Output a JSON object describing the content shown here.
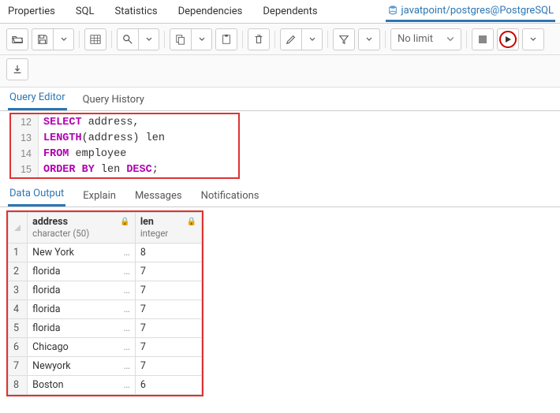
{
  "top_tabs": {
    "properties": "Properties",
    "sql": "SQL",
    "statistics": "Statistics",
    "dependencies": "Dependencies",
    "dependents": "Dependents",
    "connection": "javatpoint/postgres@PostgreSQL"
  },
  "toolbar": {
    "limit_label": "No limit"
  },
  "query_tabs": {
    "editor": "Query Editor",
    "history": "Query History"
  },
  "editor": {
    "lines": [
      {
        "num": "12",
        "tokens": [
          [
            "kw",
            "SELECT"
          ],
          [
            "pn",
            " address,"
          ]
        ]
      },
      {
        "num": "13",
        "tokens": [
          [
            "fn",
            "LENGTH"
          ],
          [
            "pn",
            "(address) len"
          ]
        ]
      },
      {
        "num": "14",
        "tokens": [
          [
            "kw",
            "FROM"
          ],
          [
            "pn",
            " employee"
          ]
        ]
      },
      {
        "num": "15",
        "tokens": [
          [
            "kw",
            "ORDER BY"
          ],
          [
            "pn",
            " len "
          ],
          [
            "kw",
            "DESC"
          ],
          [
            "pn",
            ";"
          ]
        ]
      }
    ]
  },
  "out_tabs": {
    "data": "Data Output",
    "explain": "Explain",
    "messages": "Messages",
    "notifications": "Notifications"
  },
  "columns": [
    {
      "name": "address",
      "type": "character (50)"
    },
    {
      "name": "len",
      "type": "integer"
    }
  ],
  "rows": [
    {
      "n": "1",
      "address": "New York",
      "len": "8"
    },
    {
      "n": "2",
      "address": "florida",
      "len": "7"
    },
    {
      "n": "3",
      "address": "florida",
      "len": "7"
    },
    {
      "n": "4",
      "address": "florida",
      "len": "7"
    },
    {
      "n": "5",
      "address": "florida",
      "len": "7"
    },
    {
      "n": "6",
      "address": "Chicago",
      "len": "7"
    },
    {
      "n": "7",
      "address": "Newyork",
      "len": "7"
    },
    {
      "n": "8",
      "address": "Boston",
      "len": "6"
    }
  ]
}
